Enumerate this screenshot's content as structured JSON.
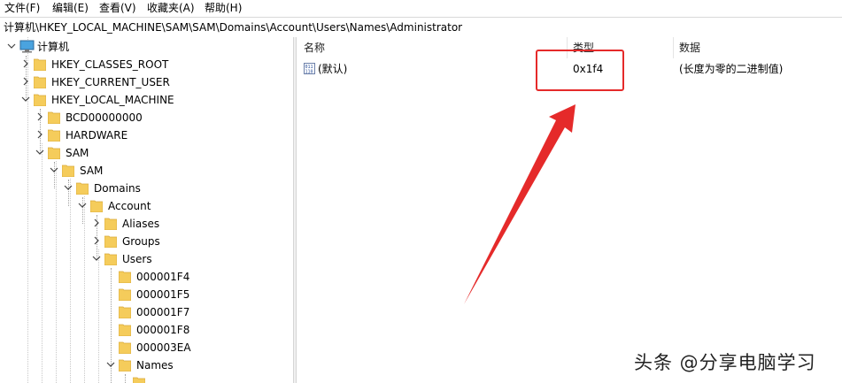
{
  "menu": [
    {
      "label": "文件(F)"
    },
    {
      "label": "编辑(E)"
    },
    {
      "label": "查看(V)"
    },
    {
      "label": "收藏夹(A)"
    },
    {
      "label": "帮助(H)"
    }
  ],
  "address": {
    "path": "计算机\\HKEY_LOCAL_MACHINE\\SAM\\SAM\\Domains\\Account\\Users\\Names\\Administrator"
  },
  "tree": {
    "root": "计算机",
    "nodes": [
      {
        "label": "HKEY_CLASSES_ROOT"
      },
      {
        "label": "HKEY_CURRENT_USER"
      },
      {
        "label": "HKEY_LOCAL_MACHINE"
      },
      {
        "label": "BCD00000000"
      },
      {
        "label": "HARDWARE"
      },
      {
        "label": "SAM"
      },
      {
        "label": "SAM"
      },
      {
        "label": "Domains"
      },
      {
        "label": "Account"
      },
      {
        "label": "Aliases"
      },
      {
        "label": "Groups"
      },
      {
        "label": "Users"
      },
      {
        "label": "000001F4"
      },
      {
        "label": "000001F5"
      },
      {
        "label": "000001F7"
      },
      {
        "label": "000001F8"
      },
      {
        "label": "000003EA"
      },
      {
        "label": "Names"
      }
    ]
  },
  "list": {
    "columns": [
      "名称",
      "类型",
      "数据"
    ],
    "rows": [
      {
        "name": "(默认)",
        "type": "0x1f4",
        "data": "(长度为零的二进制值)"
      }
    ]
  },
  "watermark": "头条 @分享电脑学习",
  "colors": {
    "highlight": "#e52a2a",
    "folder": "#f5cc5b"
  }
}
